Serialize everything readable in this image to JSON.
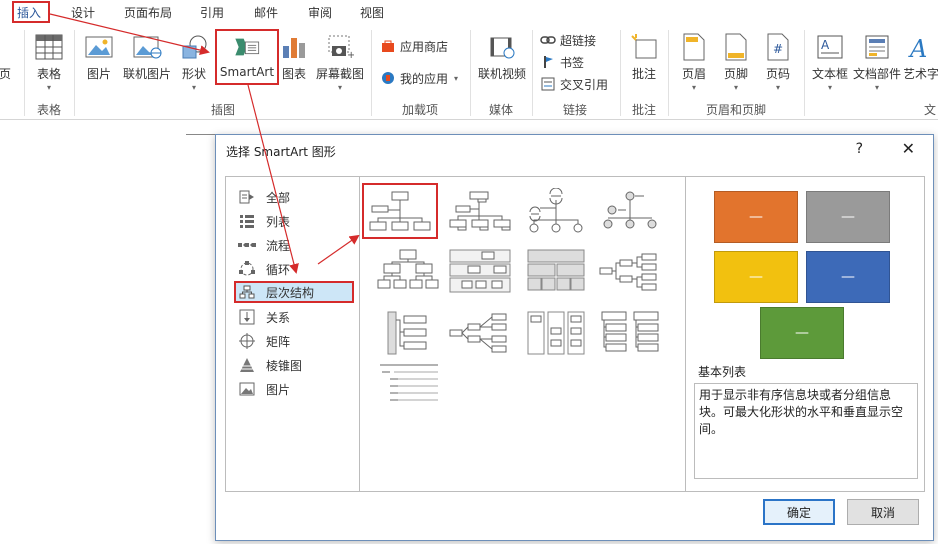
{
  "ribbon": {
    "tabs": [
      {
        "label": "插入",
        "active": true
      },
      {
        "label": "设计"
      },
      {
        "label": "页面布局"
      },
      {
        "label": "引用"
      },
      {
        "label": "邮件"
      },
      {
        "label": "审阅"
      },
      {
        "label": "视图"
      }
    ],
    "buttons": {
      "page": "页",
      "table": "表格",
      "picture": "图片",
      "online_picture": "联机图片",
      "shapes": "形状",
      "smartart": "SmartArt",
      "chart": "图表",
      "screenshot": "屏幕截图",
      "app_store": "应用商店",
      "my_apps": "我的应用",
      "online_video": "联机视频",
      "hyperlink": "超链接",
      "bookmark": "书签",
      "cross_reference": "交叉引用",
      "comment": "批注",
      "header": "页眉",
      "footer": "页脚",
      "page_number": "页码",
      "text_box": "文本框",
      "quick_parts": "文档部件",
      "wordart": "艺术字"
    },
    "groups": {
      "tables": "表格",
      "illustrations": "插图",
      "addins": "加载项",
      "media": "媒体",
      "links": "链接",
      "comments": "批注",
      "header_footer": "页眉和页脚",
      "text": "文"
    }
  },
  "dialog": {
    "title": "选择 SmartArt 图形",
    "help": "?",
    "close": "✕",
    "categories": [
      {
        "label": "全部",
        "icon": "all-icon"
      },
      {
        "label": "列表",
        "icon": "list-icon"
      },
      {
        "label": "流程",
        "icon": "process-icon"
      },
      {
        "label": "循环",
        "icon": "cycle-icon"
      },
      {
        "label": "层次结构",
        "icon": "hierarchy-icon",
        "selected": true
      },
      {
        "label": "关系",
        "icon": "relationship-icon"
      },
      {
        "label": "矩阵",
        "icon": "matrix-icon"
      },
      {
        "label": "棱锥图",
        "icon": "pyramid-icon"
      },
      {
        "label": "图片",
        "icon": "picture-icon"
      }
    ],
    "preview": {
      "swatch_text": "—",
      "colors": [
        "#e2742d",
        "#9a9a9a",
        "#f2c10f",
        "#3d6ab8",
        "#5d9a3a"
      ],
      "title": "基本列表",
      "description": "用于显示非有序信息块或者分组信息块。可最大化形状的水平和垂直显示空间。"
    },
    "ok_label": "确定",
    "cancel_label": "取消"
  },
  "colors": {
    "accent": "#2b579a",
    "highlight": "#d52b2b"
  }
}
